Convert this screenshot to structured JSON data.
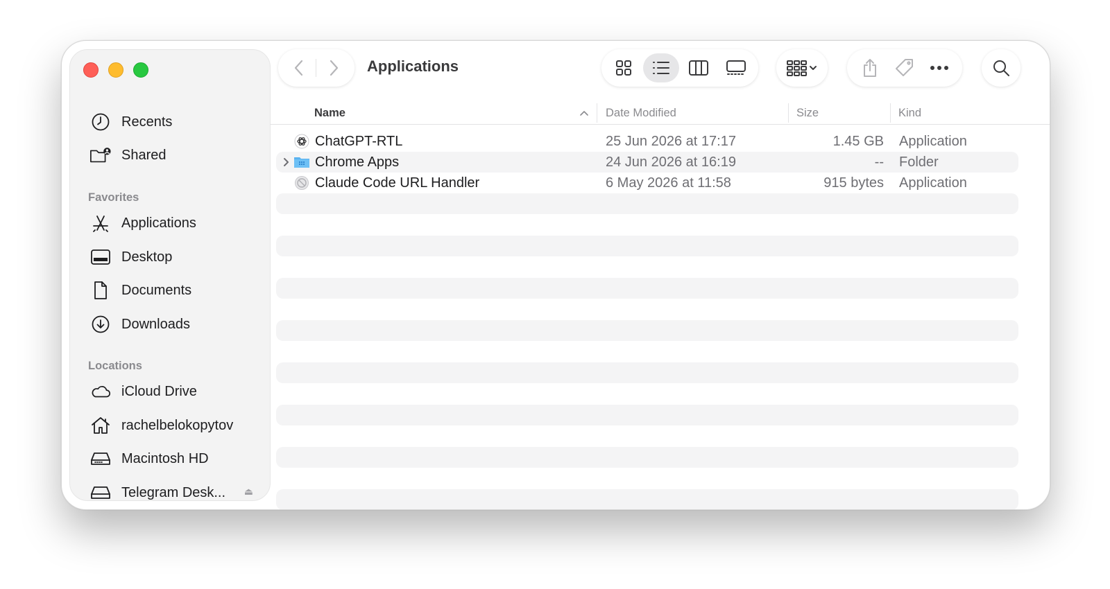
{
  "window": {
    "title": "Applications"
  },
  "sidebar": {
    "top_items": [
      {
        "label": "Recents",
        "icon": "clock-icon"
      },
      {
        "label": "Shared",
        "icon": "shared-folder-icon"
      }
    ],
    "favorites": {
      "heading": "Favorites",
      "items": [
        {
          "label": "Applications",
          "icon": "applications-icon"
        },
        {
          "label": "Desktop",
          "icon": "desktop-icon"
        },
        {
          "label": "Documents",
          "icon": "document-icon"
        },
        {
          "label": "Downloads",
          "icon": "download-icon"
        }
      ]
    },
    "locations": {
      "heading": "Locations",
      "items": [
        {
          "label": "iCloud Drive",
          "icon": "cloud-icon"
        },
        {
          "label": "rachelbelokopytov",
          "icon": "home-icon"
        },
        {
          "label": "Macintosh HD",
          "icon": "disk-icon"
        },
        {
          "label": "Telegram Desk...",
          "icon": "disk-icon",
          "eject": "⏏"
        }
      ]
    }
  },
  "columns": {
    "name": "Name",
    "date_modified": "Date Modified",
    "size": "Size",
    "kind": "Kind"
  },
  "files": [
    {
      "name": "ChatGPT-RTL",
      "date": "25 Jun 2026 at 17:17",
      "size": "1.45 GB",
      "kind": "Application",
      "icon": "chatgpt-app-icon"
    },
    {
      "name": "Chrome Apps",
      "date": "24 Jun 2026 at 16:19",
      "size": "--",
      "kind": "Folder",
      "icon": "folder-icon"
    },
    {
      "name": "Claude Code URL Handler",
      "date": "6 May 2026 at 11:58",
      "size": "915 bytes",
      "kind": "Application",
      "icon": "app-placeholder-icon"
    }
  ],
  "colors": {
    "close": "#fe5f57",
    "minimize": "#febc2e",
    "zoom": "#28c840",
    "folder": "#5ab3f0"
  }
}
